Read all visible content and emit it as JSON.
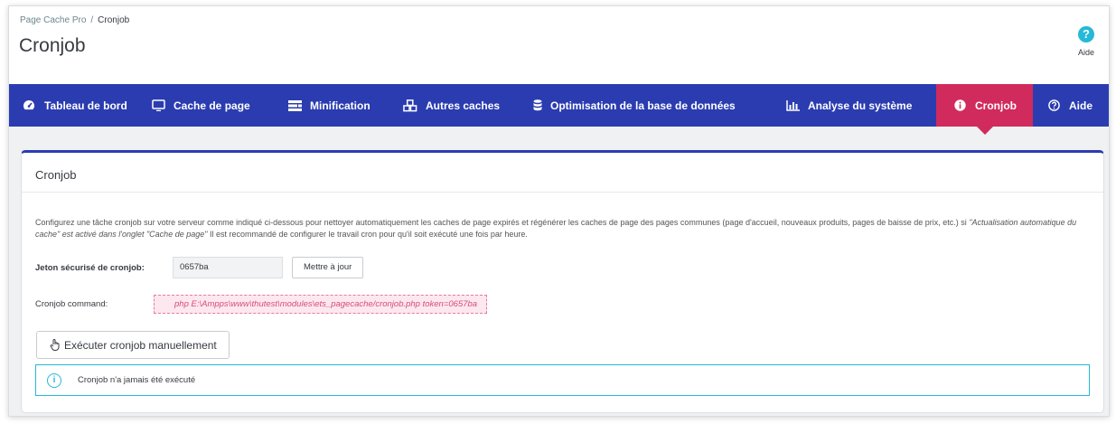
{
  "breadcrumb": {
    "parent": "Page Cache Pro",
    "separator": "/",
    "current": "Cronjob"
  },
  "page": {
    "title": "Cronjob"
  },
  "help": {
    "icon": "question-circle-icon",
    "label": "Aide"
  },
  "nav": {
    "items": [
      {
        "label": "Tableau de bord",
        "icon": "dashboard-icon"
      },
      {
        "label": "Cache de page",
        "icon": "monitor-icon"
      },
      {
        "label": "Minification",
        "icon": "minify-icon"
      },
      {
        "label": "Autres caches",
        "icon": "cubes-icon"
      },
      {
        "label": "Optimisation de la base de données",
        "icon": "database-icon"
      },
      {
        "label": "Analyse du système",
        "icon": "bar-chart-icon"
      },
      {
        "label": "Cronjob",
        "icon": "info-icon",
        "active": true
      },
      {
        "label": "Aide",
        "icon": "help-icon"
      }
    ],
    "background": "#2b3cb0",
    "active_color": "#d12a5c"
  },
  "panel": {
    "heading": "Cronjob",
    "description": {
      "part1": "Configurez une tâche cronjob sur votre serveur comme indiqué ci-dessous pour nettoyer automatiquement les caches de page expirés et régénérer les caches de page des pages communes (page d'accueil, nouveaux produits, pages de baisse de prix, etc.) si ",
      "emphasis": "\"Actualisation automatique du cache\" est activé dans l'onglet \"Cache de page\"",
      "part2": " Il est recommandé de configurer le travail cron pour qu'il soit exécuté une fois par heure."
    },
    "token": {
      "label": "Jeton sécurisé de cronjob:",
      "value": "0657ba",
      "update_button": "Mettre à jour"
    },
    "command": {
      "label": "Cronjob command:",
      "value": "php E:\\Ampps\\www\\thutest\\modules\\ets_pagecache/cronjob.php token=0657ba"
    },
    "run_button": "Exécuter cronjob manuellement",
    "alert": {
      "icon": "info-circle-icon",
      "text": "Cronjob n'a jamais été exécuté"
    }
  }
}
